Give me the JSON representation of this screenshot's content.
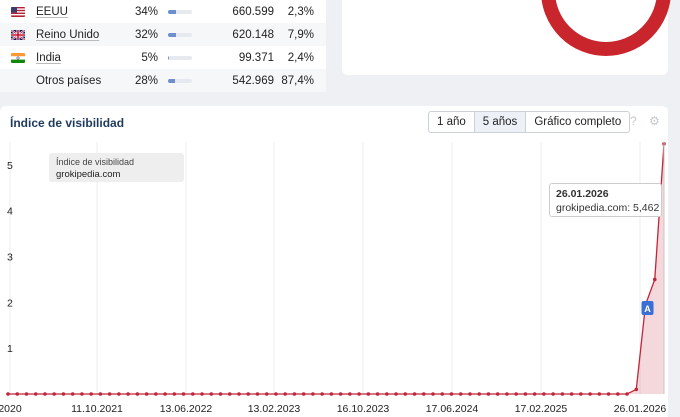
{
  "countries": [
    {
      "name": "EEUU",
      "flag": "us-flag-icon",
      "percent": "34%",
      "bar_fraction": 0.34,
      "clicks": "660.599",
      "share": "2,3%"
    },
    {
      "name": "Reino Unido",
      "flag": "uk-flag-icon",
      "percent": "32%",
      "bar_fraction": 0.32,
      "clicks": "620.148",
      "share": "7,9%"
    },
    {
      "name": "India",
      "flag": "india-flag-icon",
      "percent": "5%",
      "bar_fraction": 0.05,
      "clicks": "99.371",
      "share": "2,4%"
    },
    {
      "name": "Otros países",
      "flag": "",
      "percent": "28%",
      "bar_fraction": 0.28,
      "clicks": "542.969",
      "share": "87,4%"
    }
  ],
  "chart": {
    "title": "Índice de visibilidad",
    "range_buttons": [
      "1 año",
      "5 años",
      "Gráfico completo"
    ],
    "active_range": "5 años",
    "help_icon": "question-icon",
    "settings_icon": "gear-icon",
    "legend_tooltip": {
      "title": "Índice de visibilidad",
      "domain": "grokipedia.com"
    },
    "hover_tooltip": {
      "date": "26.01.2026",
      "line": "grokipedia.com: 5,462"
    },
    "annotation_marker": "A"
  },
  "chart_data": {
    "type": "area",
    "title": "Índice de visibilidad",
    "series": [
      {
        "name": "grokipedia.com",
        "color": "#c0263a"
      }
    ],
    "x_tick_labels": [
      "2020",
      "11.10.2021",
      "13.06.2022",
      "13.02.2023",
      "16.10.2023",
      "17.06.2024",
      "17.02.2025",
      "26.01.2026"
    ],
    "y_ticks": [
      1,
      2,
      3,
      4,
      5
    ],
    "ylim": [
      0,
      5.5
    ],
    "grid": "vertical",
    "values": [
      0,
      0,
      0,
      0,
      0,
      0,
      0,
      0,
      0,
      0,
      0,
      0,
      0,
      0,
      0,
      0,
      0,
      0,
      0,
      0,
      0,
      0,
      0,
      0,
      0,
      0,
      0,
      0,
      0,
      0,
      0,
      0,
      0,
      0,
      0,
      0,
      0,
      0,
      0,
      0,
      0,
      0,
      0,
      0,
      0,
      0,
      0,
      0,
      0,
      0,
      0,
      0,
      0,
      0,
      0,
      0,
      0,
      0,
      0,
      0,
      0,
      0,
      0,
      0,
      0,
      0,
      0,
      0,
      0.1,
      1.95,
      2.5,
      5.462
    ],
    "points": [
      {
        "date": "26.01.2026",
        "value": 5.462
      }
    ]
  },
  "colors": {
    "accent_navy": "#1f3b5c",
    "series_red": "#c0263a",
    "donut_red": "#c9252c",
    "marker_blue": "#3b6fd6"
  }
}
